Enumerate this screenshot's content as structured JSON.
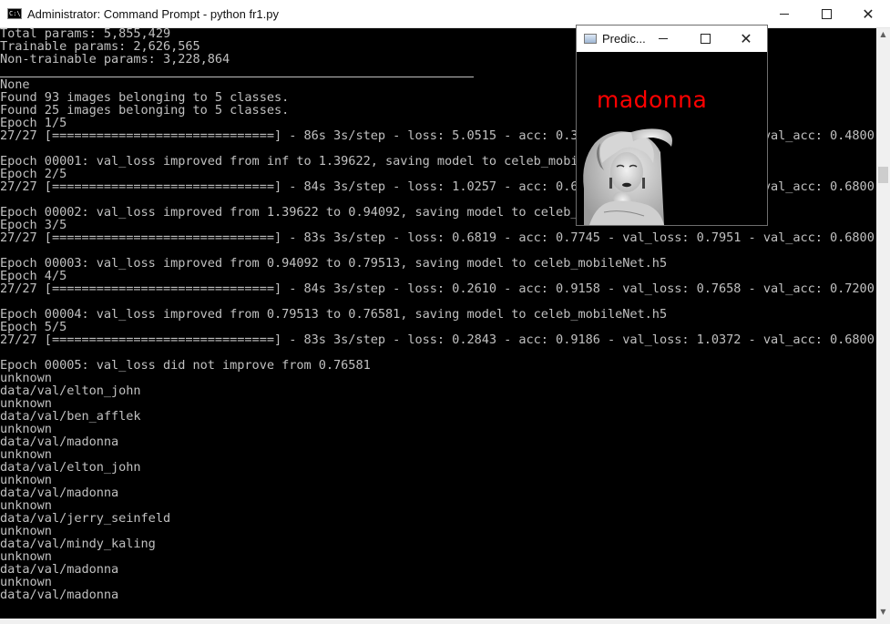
{
  "window": {
    "title": "Administrator: Command Prompt - python  fr1.py",
    "icon": "cmd-icon",
    "controls": [
      "minimize-icon",
      "maximize-icon",
      "close-icon"
    ]
  },
  "console": {
    "lines": [
      "Total params: 5,855,429",
      "Trainable params: 2,626,565",
      "Non-trainable params: 3,228,864",
      "",
      "None",
      "Found 93 images belonging to 5 classes.",
      "Found 25 images belonging to 5 classes.",
      "Epoch 1/5",
      "27/27 [==============================] - 86s 3s/step - loss: 5.0515 - acc: 0.3462 - val_loss: 1.3962 - val_acc: 0.4800",
      "",
      "Epoch 00001: val_loss improved from inf to 1.39622, saving model to celeb_mobileNet.h5",
      "Epoch 2/5",
      "27/27 [==============================] - 84s 3s/step - loss: 1.0257 - acc: 0.6806 - val_loss: 0.9409 - val_acc: 0.6800",
      "",
      "Epoch 00002: val_loss improved from 1.39622 to 0.94092, saving model to celeb_mobileNet.h5",
      "Epoch 3/5",
      "27/27 [==============================] - 83s 3s/step - loss: 0.6819 - acc: 0.7745 - val_loss: 0.7951 - val_acc: 0.6800",
      "",
      "Epoch 00003: val_loss improved from 0.94092 to 0.79513, saving model to celeb_mobileNet.h5",
      "Epoch 4/5",
      "27/27 [==============================] - 84s 3s/step - loss: 0.2610 - acc: 0.9158 - val_loss: 0.7658 - val_acc: 0.7200",
      "",
      "Epoch 00004: val_loss improved from 0.79513 to 0.76581, saving model to celeb_mobileNet.h5",
      "Epoch 5/5",
      "27/27 [==============================] - 83s 3s/step - loss: 0.2843 - acc: 0.9186 - val_loss: 1.0372 - val_acc: 0.6800",
      "",
      "Epoch 00005: val_loss did not improve from 0.76581",
      "unknown",
      "data/val/elton_john",
      "unknown",
      "data/val/ben_afflek",
      "unknown",
      "data/val/madonna",
      "unknown",
      "data/val/elton_john",
      "unknown",
      "data/val/madonna",
      "unknown",
      "data/val/jerry_seinfeld",
      "unknown",
      "data/val/mindy_kaling",
      "unknown",
      "data/val/madonna",
      "unknown",
      "data/val/madonna"
    ]
  },
  "prediction_window": {
    "title": "Predic...",
    "label": "madonna",
    "label_color": "#ff0000",
    "image": "portrait-photo"
  },
  "scrollbar": {
    "up_arrow": "scroll-up-icon",
    "down_arrow": "scroll-down-icon"
  }
}
